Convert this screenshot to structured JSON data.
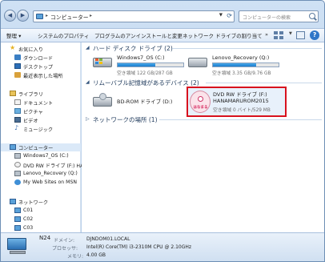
{
  "window": {
    "title": "コンピューター"
  },
  "address": {
    "path_label": "コンピューター"
  },
  "search": {
    "placeholder": "コンピューターの検索"
  },
  "toolbar": {
    "items": [
      "整理 ▾",
      "システムのプロパティ",
      "プログラムのアンインストールと変更",
      "ネットワーク ドライブの割り当て",
      "»"
    ]
  },
  "sidebar": {
    "favorites_label": "お気に入り",
    "favorites": [
      "ダウンロード",
      "デスクトップ",
      "最近表示した場所"
    ],
    "libraries_label": "ライブラリ",
    "libraries": [
      "ドキュメント",
      "ピクチャ",
      "ビデオ",
      "ミュージック"
    ],
    "computer_label": "コンピューター",
    "computer_items": [
      "Windows7_OS (C:)",
      "DVD RW ドライブ (F:) HA",
      "Lenovo_Recovery (Q:)",
      "My Web Sites on MSN"
    ],
    "network_label": "ネットワーク",
    "network_items": [
      "C01",
      "C02",
      "C03"
    ]
  },
  "groups": {
    "hdd_header": "ハード ディスク ドライブ (2)",
    "removable_header": "リムーバブル記憶域があるデバイス (2)",
    "network_header": "ネットワークの場所 (1)"
  },
  "drives": {
    "c": {
      "name": "Windows7_OS (C:)",
      "free": "空き領域 122 GB/287 GB",
      "used_fraction": 0.57
    },
    "q": {
      "name": "Lenovo_Recovery (Q:)",
      "free": "空き領域 3.35 GB/9.76 GB",
      "used_fraction": 0.66
    },
    "d": {
      "name": "BD-ROM ドライブ (D:)"
    },
    "f": {
      "name": "DVD RW ドライブ (F:)",
      "label": "HANAMARUROM2015",
      "free": "空き領域 0 バイト/529 MB",
      "disc_text": "はなまる"
    }
  },
  "status": {
    "name": "N24",
    "domain_key": "ドメイン:",
    "domain_val": "DJNDOM01.LOCAL",
    "cpu_key": "プロセッサ:",
    "cpu_val": "Intel(R) Core(TM) i3-2310M CPU @ 2.10GHz",
    "mem_key": "メモリ:",
    "mem_val": "4.00 GB"
  },
  "colors": {
    "highlight_border": "#d8121e",
    "bar_fill": "#1b7ccd"
  }
}
